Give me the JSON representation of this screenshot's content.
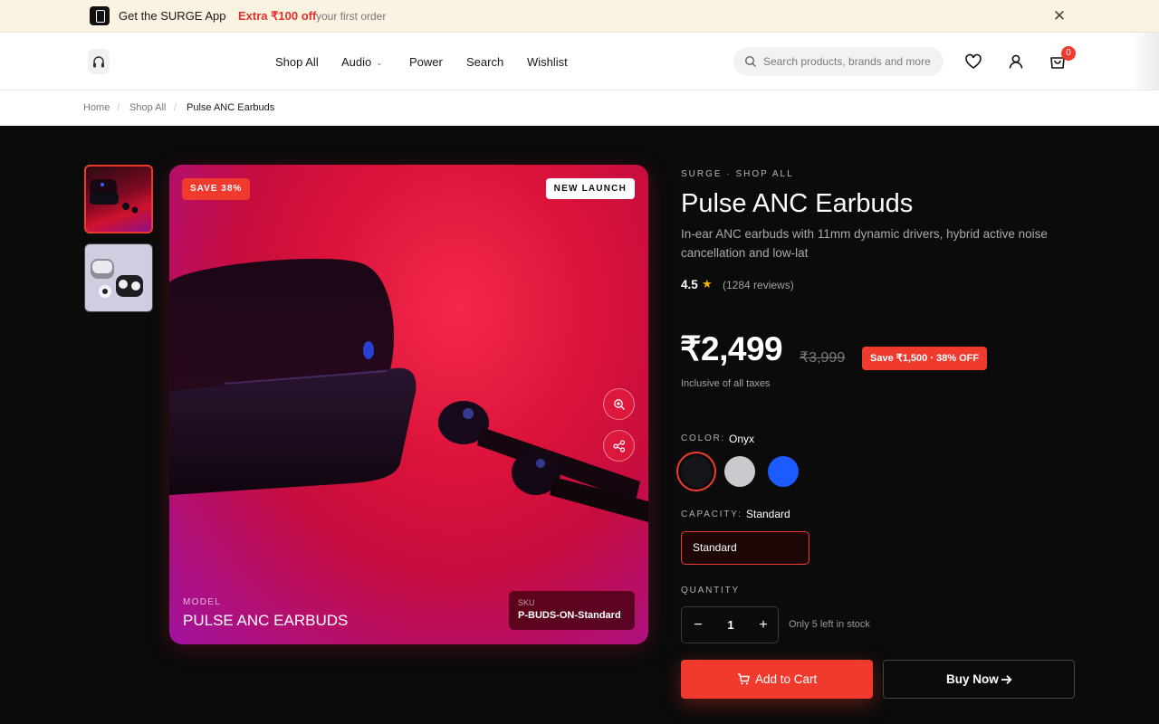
{
  "promo": {
    "app_text": "Get the SURGE App",
    "separator": "·",
    "offer": "Extra ₹100 off",
    "subtext": "your first order"
  },
  "header": {
    "nav": [
      "Shop All",
      "Audio",
      "Power",
      "Search",
      "Wishlist"
    ],
    "search_placeholder": "Search products, brands and more",
    "cart_count": "0"
  },
  "breadcrumb": {
    "items": [
      "Home",
      "Shop All",
      "Pulse ANC Earbuds"
    ],
    "separator": "/"
  },
  "gallery": {
    "save_badge": "SAVE 38%",
    "new_badge": "NEW LAUNCH",
    "model_label": "MODEL",
    "model_name": "PULSE ANC EARBUDS",
    "sku_label": "SKU",
    "sku_value": "P-BUDS-ON-Standard"
  },
  "product": {
    "eyebrow": "SURGE · SHOP ALL",
    "title": "Pulse ANC Earbuds",
    "description": "In-ear ANC earbuds with 11mm dynamic drivers, hybrid active noise cancellation and low-lat",
    "rating": "4.5",
    "reviews": "(1284 reviews)",
    "price": "₹2,499",
    "mrp": "₹3,999",
    "save_chip": "Save ₹1,500 · 38% OFF",
    "taxes": "Inclusive of all taxes",
    "color_label": "COLOR:",
    "color_value": "Onyx",
    "colors": [
      "#15161a",
      "#c9cacd",
      "#1c5cff"
    ],
    "capacity_label": "CAPACITY:",
    "capacity_value": "Standard",
    "capacity_option": "Standard",
    "quantity_label": "QUANTITY",
    "quantity": "1",
    "minus": "−",
    "plus": "+",
    "stock": "Only 5 left in stock",
    "add_to_cart": "Add to Cart",
    "buy_now": "Buy Now"
  },
  "colors": {
    "accent": "#f03a2e",
    "page_bg": "#0b0b0b",
    "promo_bg": "#fbf3e2"
  }
}
